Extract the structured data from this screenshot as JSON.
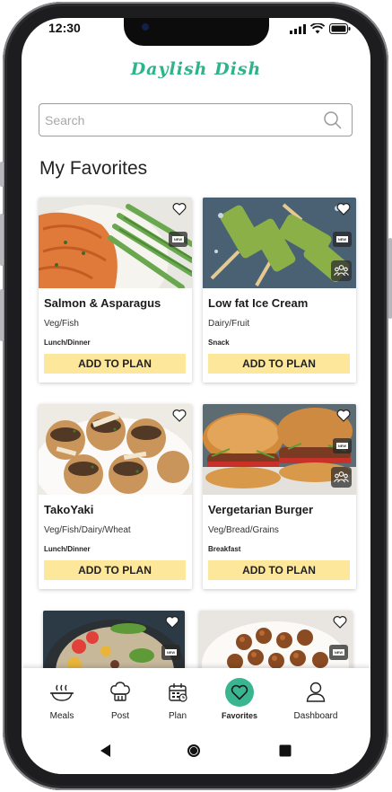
{
  "status": {
    "time": "12:30"
  },
  "app": {
    "logo": "Daylish Dish"
  },
  "search": {
    "placeholder": "Search"
  },
  "section": {
    "title": "My Favorites"
  },
  "cards": [
    {
      "title": "Salmon & Asparagus",
      "category": "Veg/Fish",
      "meal": "Lunch/Dinner",
      "action": "ADD TO PLAN",
      "badge": "NEW"
    },
    {
      "title": "Low fat Ice Cream",
      "category": "Dairy/Fruit",
      "meal": "Snack",
      "action": "ADD TO PLAN",
      "badge": "NEW"
    },
    {
      "title": "TakoYaki",
      "category": "Veg/Fish/Dairy/Wheat",
      "meal": "Lunch/Dinner",
      "action": "ADD TO PLAN"
    },
    {
      "title": "Vergetarian Burger",
      "category": "Veg/Bread/Grains",
      "meal": "Breakfast",
      "action": "ADD TO PLAN",
      "badge": "NEW"
    },
    {
      "badge": "NEW"
    },
    {
      "badge": "NEW"
    }
  ],
  "nav": [
    {
      "label": "Meals",
      "icon": "bowl-icon"
    },
    {
      "label": "Post",
      "icon": "chef-hat-icon"
    },
    {
      "label": "Plan",
      "icon": "calendar-icon"
    },
    {
      "label": "Favorites",
      "icon": "heart-icon",
      "active": true
    },
    {
      "label": "Dashboard",
      "icon": "user-icon"
    }
  ],
  "colors": {
    "brand": "#2fb38a",
    "active_nav": "#39b68f",
    "add_button": "#fce79b"
  }
}
